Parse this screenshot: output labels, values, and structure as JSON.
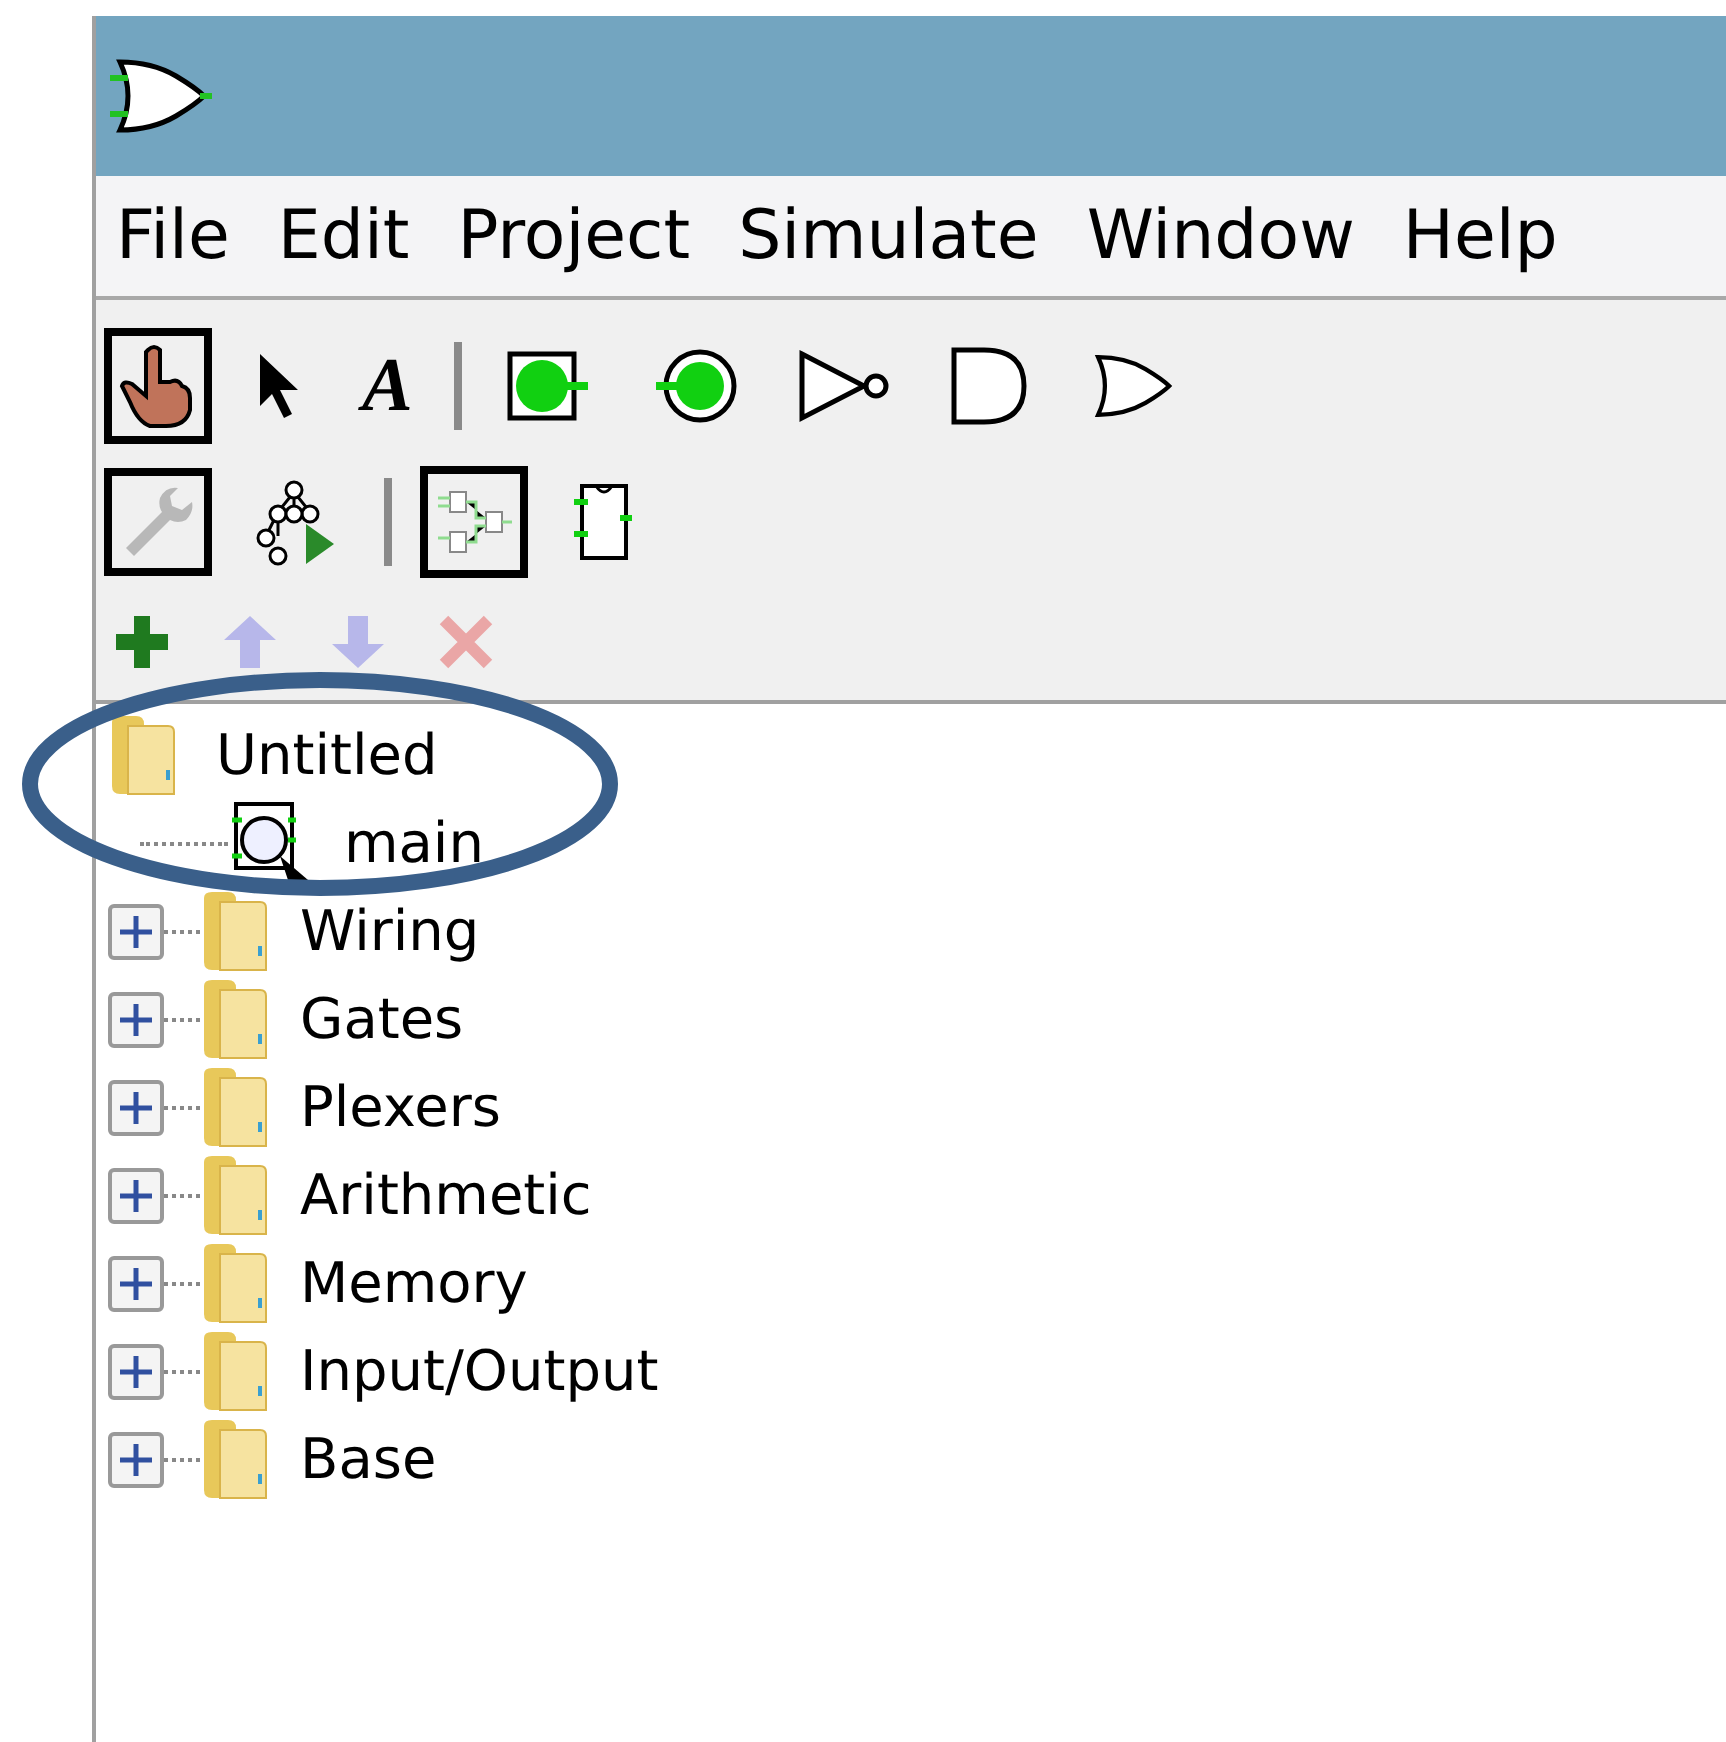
{
  "menu": [
    "File",
    "Edit",
    "Project",
    "Simulate",
    "Window",
    "Help"
  ],
  "tools": [
    {
      "kind": "poke",
      "selected": true
    },
    {
      "kind": "select",
      "selected": false
    },
    {
      "kind": "text",
      "label": "A",
      "selected": false
    },
    {
      "kind": "separator"
    },
    {
      "kind": "input-pin",
      "selected": false
    },
    {
      "kind": "output-pin",
      "selected": false
    },
    {
      "kind": "not-gate",
      "selected": false
    },
    {
      "kind": "and-gate",
      "selected": false
    },
    {
      "kind": "or-gate",
      "selected": false
    }
  ],
  "view_tools": [
    {
      "kind": "wrench",
      "selected": true
    },
    {
      "kind": "tree",
      "selected": false
    },
    {
      "kind": "separator"
    },
    {
      "kind": "layout",
      "selected": true
    },
    {
      "kind": "appearance",
      "selected": false
    }
  ],
  "project_tools": [
    {
      "kind": "add",
      "disabled": false
    },
    {
      "kind": "up",
      "disabled": true
    },
    {
      "kind": "down",
      "disabled": true
    },
    {
      "kind": "delete",
      "disabled": true
    }
  ],
  "tree": [
    {
      "label": "Untitled",
      "kind": "project",
      "children": [
        {
          "label": "main",
          "kind": "circuit"
        }
      ]
    },
    {
      "label": "Wiring",
      "kind": "library",
      "expanded": false
    },
    {
      "label": "Gates",
      "kind": "library",
      "expanded": false
    },
    {
      "label": "Plexers",
      "kind": "library",
      "expanded": false
    },
    {
      "label": "Arithmetic",
      "kind": "library",
      "expanded": false
    },
    {
      "label": "Memory",
      "kind": "library",
      "expanded": false
    },
    {
      "label": "Input/Output",
      "kind": "library",
      "expanded": false
    },
    {
      "label": "Base",
      "kind": "library",
      "expanded": false
    }
  ]
}
